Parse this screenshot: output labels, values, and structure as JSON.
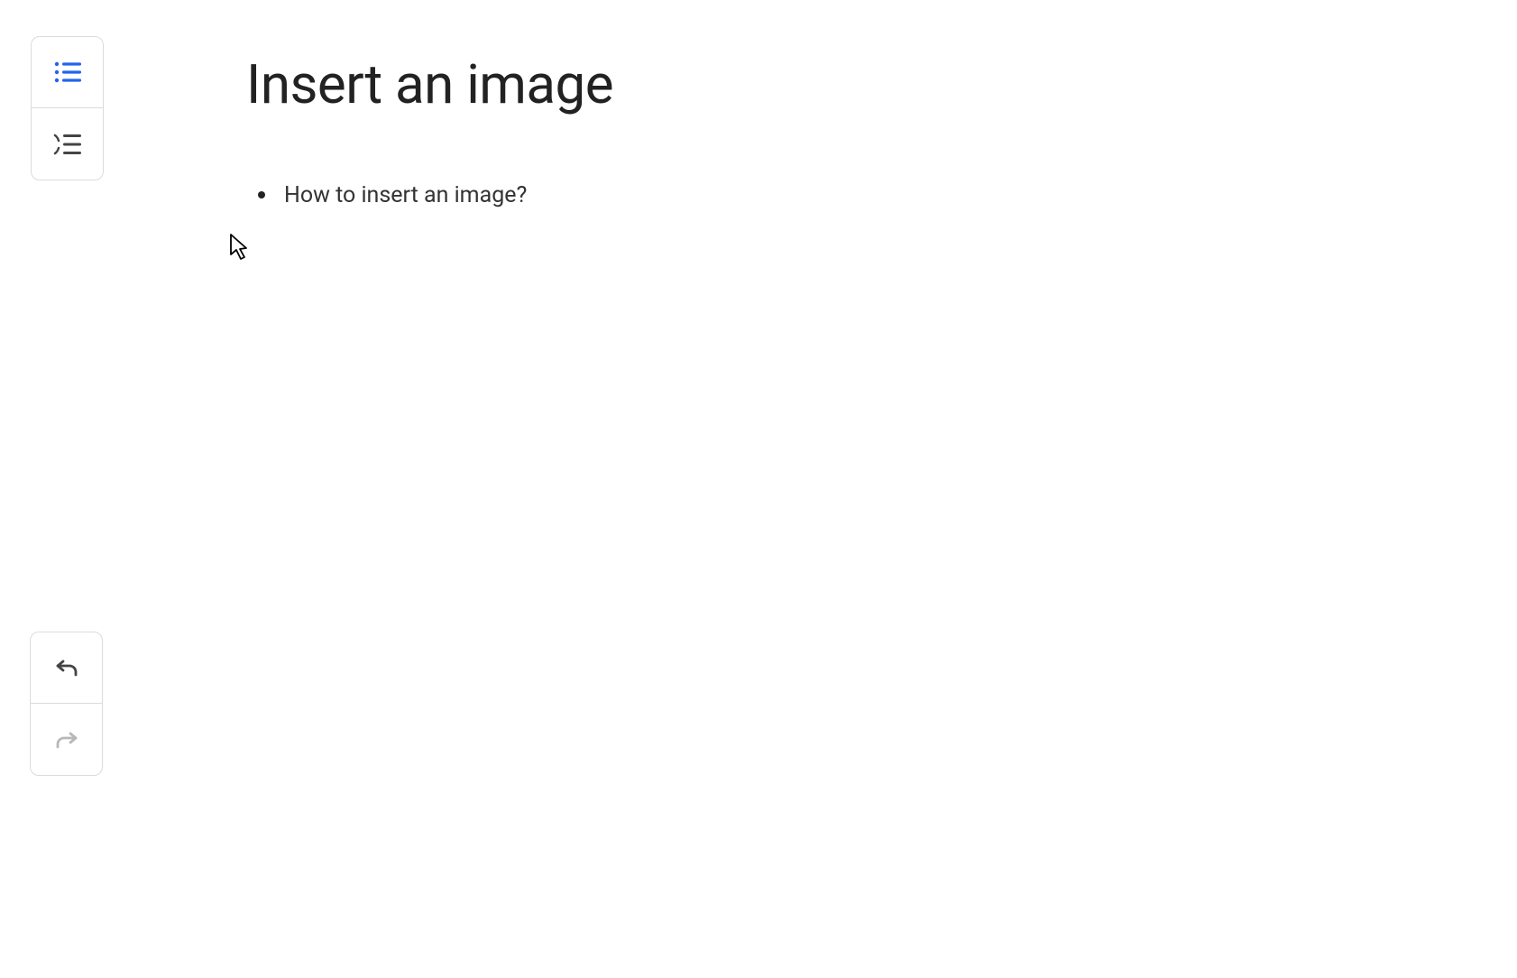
{
  "page": {
    "title": "Insert an image",
    "list_items": [
      "How to insert an image?"
    ]
  },
  "toolbar_top": {
    "bullet_list_label": "bullet-list",
    "outline_label": "outline"
  },
  "toolbar_bottom": {
    "undo_label": "undo",
    "redo_label": "redo"
  },
  "colors": {
    "accent": "#2563eb",
    "text": "#222222",
    "icon_default": "#444444",
    "icon_disabled": "#a0a0a0",
    "border": "#d9dce0"
  }
}
